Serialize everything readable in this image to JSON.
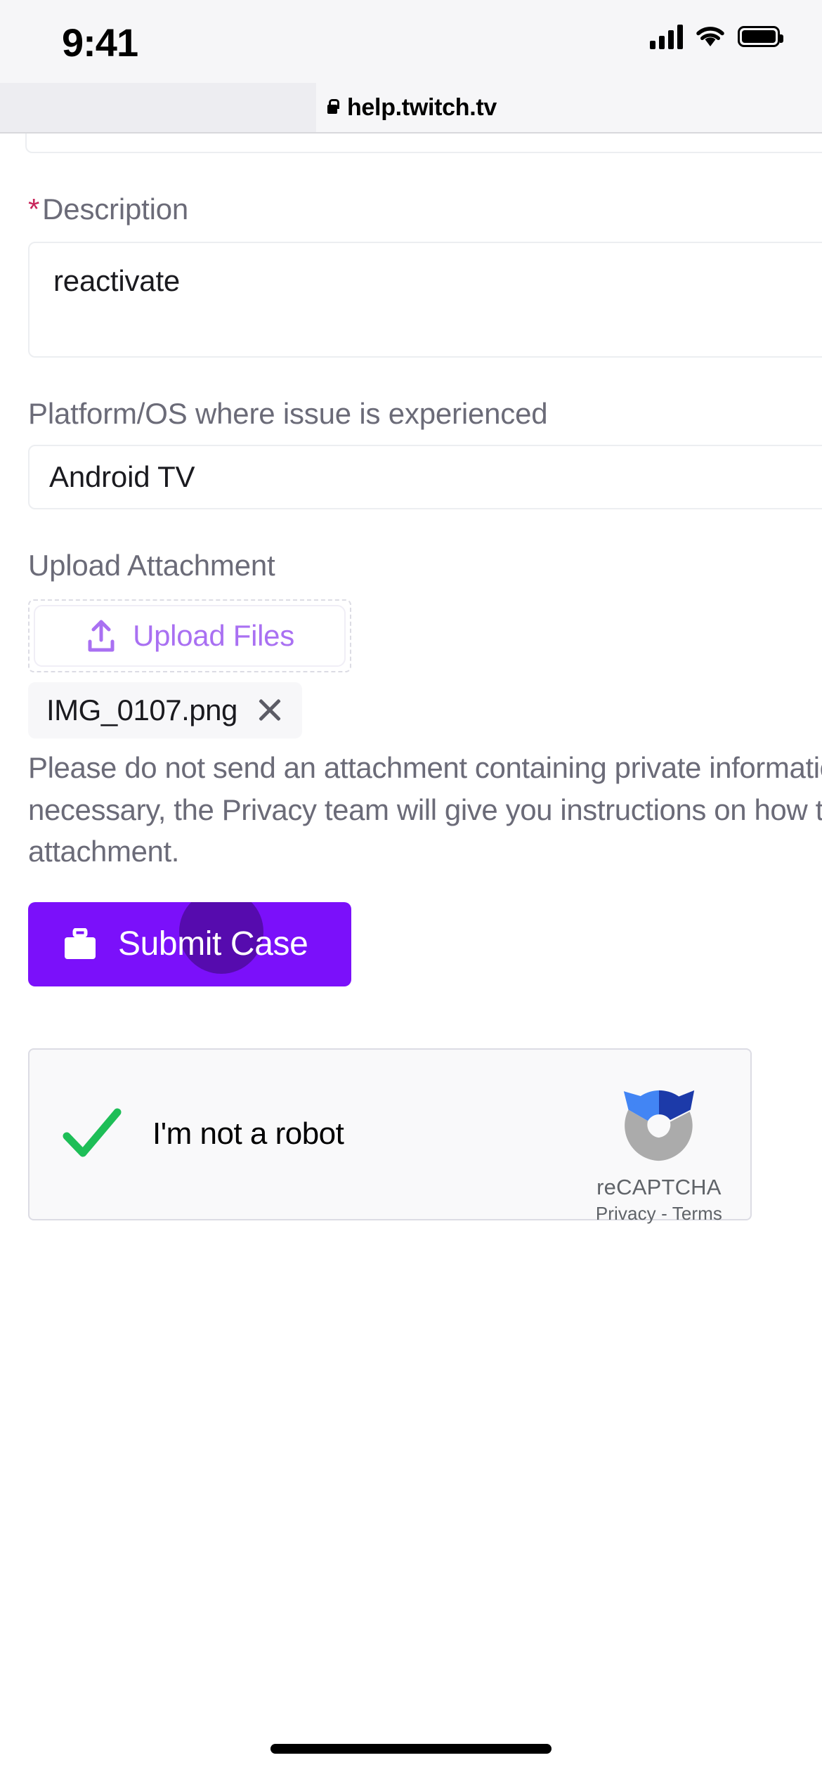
{
  "status_bar": {
    "time": "9:41",
    "signal_icon": "cellular-signal-icon",
    "wifi_icon": "wifi-icon",
    "battery_icon": "battery-full-icon"
  },
  "browser": {
    "lock_icon": "lock-icon",
    "url": "help.twitch.tv"
  },
  "form": {
    "description": {
      "required_marker": "*",
      "label": "Description",
      "value": "reactivate"
    },
    "platform": {
      "label": "Platform/OS where issue is experienced",
      "value": "Android TV"
    },
    "upload": {
      "label": "Upload Attachment",
      "button_label": "Upload Files",
      "button_icon": "upload-icon",
      "attached_file": "IMG_0107.png",
      "remove_icon": "close-x-icon",
      "notice": "Please do not send an attachment containing private information. When necessary, the Privacy team will give you instructions on how to send the attachment."
    },
    "submit": {
      "label": "Submit Case",
      "icon": "briefcase-icon",
      "background_color": "#7b10fa",
      "text_color": "#ffffff"
    }
  },
  "recaptcha": {
    "checkbox_label": "I'm not a robot",
    "checked": true,
    "check_icon": "green-checkmark-icon",
    "check_color": "#1ebe57",
    "logo_icon": "recaptcha-logo-icon",
    "brand": "reCAPTCHA",
    "privacy_label": "Privacy",
    "separator": "-",
    "terms_label": "Terms"
  },
  "system": {
    "home_indicator": "home-indicator"
  }
}
